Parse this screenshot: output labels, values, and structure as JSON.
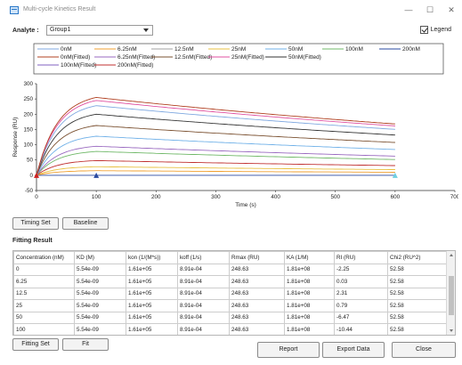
{
  "window": {
    "title": "Multi-cycle Kinetics Result",
    "minimize": "—",
    "maximize": "☐",
    "close": "✕"
  },
  "analyte": {
    "label": "Analyte :",
    "selected": "Group1"
  },
  "legend_toggle": {
    "label": "Legend",
    "checked": true
  },
  "chart_data": {
    "type": "line",
    "xlabel": "Time (s)",
    "ylabel": "Response (RU)",
    "xlim": [
      0,
      700
    ],
    "ylim": [
      -50,
      300
    ],
    "xticks": [
      0,
      100,
      200,
      300,
      400,
      500,
      600,
      700
    ],
    "yticks": [
      -50,
      0,
      50,
      100,
      150,
      200,
      250,
      300
    ],
    "association_end": 100,
    "dissociation_end": 600,
    "legend_position": "top",
    "legend": [
      {
        "name": "0nM",
        "color": "#7fa8e0"
      },
      {
        "name": "6.25nM",
        "color": "#f0a030"
      },
      {
        "name": "12.5nM",
        "color": "#a0a0a0"
      },
      {
        "name": "25nM",
        "color": "#e8c040"
      },
      {
        "name": "50nM",
        "color": "#6fb0e8"
      },
      {
        "name": "100nM",
        "color": "#70b868"
      },
      {
        "name": "200nM",
        "color": "#2a4aa0"
      },
      {
        "name": "0nM(Fitted)",
        "color": "#b04020"
      },
      {
        "name": "6.25nM(Fitted)",
        "color": "#9a6ac0"
      },
      {
        "name": "12.5nM(Fitted)",
        "color": "#7a5030"
      },
      {
        "name": "25nM(Fitted)",
        "color": "#e050a0"
      },
      {
        "name": "50nM(Fitted)",
        "color": "#333333"
      },
      {
        "name": "100nM(Fitted)",
        "color": "#8060c0"
      },
      {
        "name": "200nM(Fitted)",
        "color": "#c03030"
      }
    ],
    "curves": [
      {
        "plateau": 0,
        "color": "#2a4aa0"
      },
      {
        "plateau": 15,
        "color": "#f0a030"
      },
      {
        "plateau": 28,
        "color": "#e8c040"
      },
      {
        "plateau": 48,
        "color": "#c03030"
      },
      {
        "plateau": 78,
        "color": "#70b868"
      },
      {
        "plateau": 95,
        "color": "#9a6ac0"
      },
      {
        "plateau": 128,
        "color": "#6fb0e8"
      },
      {
        "plateau": 163,
        "color": "#7a5030"
      },
      {
        "plateau": 200,
        "color": "#333333"
      },
      {
        "plateau": 228,
        "color": "#7fa8e0"
      },
      {
        "plateau": 245,
        "color": "#e050a0"
      },
      {
        "plateau": 255,
        "color": "#b04020"
      }
    ]
  },
  "buttons": {
    "timing_set": "Timing Set",
    "baseline": "Baseline",
    "fitting_set": "Fitting Set",
    "fit": "Fit",
    "report": "Report",
    "export_data": "Export Data",
    "close": "Close"
  },
  "fitting_result": {
    "title": "Fitting Result",
    "columns": [
      "Concentration (nM)",
      "KD (M)",
      "kon (1/(M*s))",
      "koff (1/s)",
      "Rmax (RU)",
      "KA (1/M)",
      "RI (RU)",
      "Chi2 (RU^2)"
    ],
    "rows": [
      [
        "0",
        "5.54e-09",
        "1.61e+05",
        "8.91e-04",
        "248.63",
        "1.81e+08",
        "-2.25",
        "52.58"
      ],
      [
        "6.25",
        "5.54e-09",
        "1.61e+05",
        "8.91e-04",
        "248.63",
        "1.81e+08",
        "0.03",
        "52.58"
      ],
      [
        "12.5",
        "5.54e-09",
        "1.61e+05",
        "8.91e-04",
        "248.63",
        "1.81e+08",
        "2.31",
        "52.58"
      ],
      [
        "25",
        "5.54e-09",
        "1.61e+05",
        "8.91e-04",
        "248.63",
        "1.81e+08",
        "0.79",
        "52.58"
      ],
      [
        "50",
        "5.54e-09",
        "1.61e+05",
        "8.91e-04",
        "248.63",
        "1.81e+08",
        "-6.47",
        "52.58"
      ],
      [
        "100",
        "5.54e-09",
        "1.61e+05",
        "8.91e-04",
        "248.63",
        "1.81e+08",
        "-10.44",
        "52.58"
      ]
    ]
  }
}
